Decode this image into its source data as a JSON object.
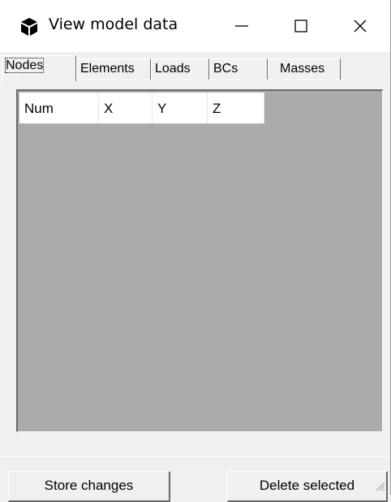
{
  "window": {
    "title": "View model data",
    "controls": {
      "minimize": "—",
      "maximize": "☐",
      "close": "✕"
    }
  },
  "tabs": [
    {
      "label": "Nodes",
      "active": true
    },
    {
      "label": "Elements",
      "active": false
    },
    {
      "label": "Loads",
      "active": false
    },
    {
      "label": "BCs",
      "active": false
    },
    {
      "label": "Masses",
      "active": false
    }
  ],
  "list": {
    "columns": [
      "Num",
      "X",
      "Y",
      "Z"
    ],
    "rows": []
  },
  "buttons": {
    "store_changes": "Store changes",
    "delete_selected": "Delete selected"
  },
  "colors": {
    "list_background": "#ababab",
    "window_background": "#f0f0f0"
  },
  "icons": {
    "app": "cube-icon",
    "grip": "resize-grip-icon"
  }
}
